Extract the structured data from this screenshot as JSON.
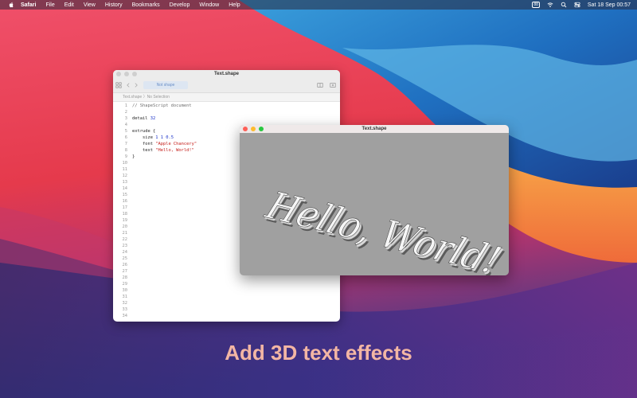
{
  "menubar": {
    "items": [
      "Safari",
      "File",
      "Edit",
      "View",
      "History",
      "Bookmarks",
      "Develop",
      "Window",
      "Help"
    ],
    "battery_badge": "88",
    "datetime": "Sat 18 Sep  00:57"
  },
  "editor": {
    "title": "Text.shape",
    "tab_label": "Not shape",
    "breadcrumb": "Text.shape 〉No Selection",
    "lines": [
      {
        "n": "1",
        "t": "// ShapeScript document"
      },
      {
        "n": "2",
        "t": ""
      },
      {
        "n": "3",
        "t": "detail 32"
      },
      {
        "n": "4",
        "t": ""
      },
      {
        "n": "5",
        "t": "extrude {"
      },
      {
        "n": "6",
        "t": "    size 1 1 0.5"
      },
      {
        "n": "7",
        "t": "    font \"Apple Chancery\""
      },
      {
        "n": "8",
        "t": "    text \"Hello, World!\""
      },
      {
        "n": "9",
        "t": "}"
      }
    ],
    "extra_line_numbers": [
      "10",
      "11",
      "12",
      "13",
      "14",
      "15",
      "16",
      "17",
      "18",
      "19",
      "20",
      "21",
      "22",
      "23",
      "24",
      "25",
      "26",
      "27",
      "28",
      "29",
      "30",
      "31",
      "32",
      "33",
      "34"
    ]
  },
  "preview": {
    "title": "Text.shape",
    "rendered_text": "Hello, World!"
  },
  "caption": "Add 3D text effects",
  "colors": {
    "caption": "#f3b6a4",
    "number": "#1c33c8",
    "string": "#c41a16"
  }
}
